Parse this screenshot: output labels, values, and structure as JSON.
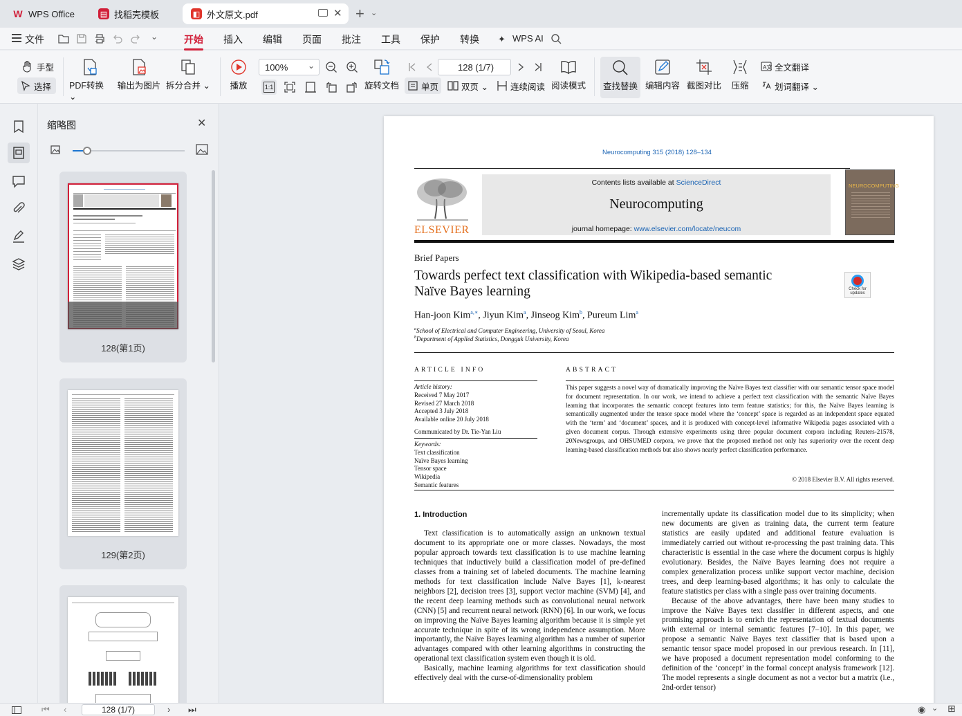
{
  "tabs": [
    {
      "label": "WPS Office"
    },
    {
      "label": "找稻壳模板"
    },
    {
      "label": "外文原文.pdf"
    }
  ],
  "menu": {
    "file": "文件",
    "items": [
      "开始",
      "插入",
      "编辑",
      "页面",
      "批注",
      "工具",
      "保护",
      "转换"
    ],
    "ai": "WPS AI"
  },
  "ribbon": {
    "hand": "手型",
    "select": "选择",
    "pdf_convert": "PDF转换",
    "export_image": "输出为图片",
    "split_merge": "拆分合并",
    "play": "播放",
    "zoom": "100%",
    "rotate": "旋转文档",
    "page_input": "128 (1/7)",
    "single": "单页",
    "double": "双页",
    "continuous": "连续阅读",
    "reading": "阅读模式",
    "find_replace": "查找替换",
    "edit_content": "编辑内容",
    "screenshot_compare": "截图对比",
    "compress": "压缩",
    "full_translate": "全文翻译",
    "word_translate": "划词翻译"
  },
  "thumbs": {
    "title": "缩略图",
    "pages": [
      {
        "label": "128(第1页)"
      },
      {
        "label": "129(第2页)"
      }
    ]
  },
  "status": {
    "page": "128 (1/7)"
  },
  "paper": {
    "journal_ref": "Neurocomputing 315 (2018) 128–134",
    "contents_prefix": "Contents lists available at ",
    "contents_link": "ScienceDirect",
    "journal": "Neurocomputing",
    "homepage_prefix": "journal homepage: ",
    "homepage_link": "www.elsevier.com/locate/neucom",
    "publisher": "ELSEVIER",
    "cover_title": "NEUROCOMPUTING",
    "badge": "Check for updates",
    "section_type": "Brief Papers",
    "title_line1": "Towards perfect text classification with Wikipedia-based semantic",
    "title_line2": "Naïve Bayes learning",
    "authors": [
      {
        "name": "Han-joon Kim",
        "sup": "a,∗"
      },
      {
        "name": "Jiyun Kim",
        "sup": "a"
      },
      {
        "name": "Jinseog Kim",
        "sup": "b"
      },
      {
        "name": "Pureum Lim",
        "sup": "a"
      }
    ],
    "aff_a": "School of Electrical and Computer Engineering, University of Seoul, Korea",
    "aff_b": "Department of Applied Statistics, Dongguk University, Korea",
    "article_info_heading": "ARTICLE INFO",
    "history_label": "Article history:",
    "history": [
      "Received 7 May 2017",
      "Revised 27 March 2018",
      "Accepted 3 July 2018",
      "Available online 20 July 2018"
    ],
    "communicated": "Communicated by Dr. Tie-Yan Liu",
    "keywords_label": "Keywords:",
    "keywords": [
      "Text classification",
      "Naïve Bayes learning",
      "Tensor space",
      "Wikipedia",
      "Semantic features"
    ],
    "abstract_heading": "ABSTRACT",
    "abstract": "This paper suggests a novel way of dramatically improving the Naïve Bayes text classifier with our semantic tensor space model for document representation. In our work, we intend to achieve a perfect text classification with the semantic Naïve Bayes learning that incorporates the semantic concept features into term feature statistics; for this, the Naïve Bayes learning is semantically augmented under the tensor space model where the ‘concept’ space is regarded as an independent space equated with the ‘term’ and ‘document’ spaces, and it is produced with concept-level informative Wikipedia pages associated with a given document corpus. Through extensive experiments using three popular document corpora including Reuters-21578, 20Newsgroups, and OHSUMED corpora, we prove that the proposed method not only has superiority over the recent deep learning-based classification methods but also shows nearly perfect classification performance.",
    "copyright": "© 2018 Elsevier B.V. All rights reserved.",
    "intro_heading": "1. Introduction",
    "intro_p1": "Text classification is to automatically assign an unknown textual document to its appropriate one or more classes. Nowadays, the most popular approach towards text classification is to use machine learning techniques that inductively build a classification model of pre-defined classes from a training set of labeled documents. The machine learning methods for text classification include Naïve Bayes [1], k-nearest neighbors [2], decision trees [3], support vector machine (SVM) [4], and the recent deep learning methods such as convolutional neural network (CNN) [5] and recurrent neural network (RNN) [6]. In our work, we focus on improving the Naïve Bayes learning algorithm because it is simple yet accurate technique in spite of its wrong independence assumption. More importantly, the Naïve Bayes learning algorithm has a number of superior advantages compared with other learning algorithms in constructing the operational text classification system even though it is old.",
    "intro_p2": "Basically, machine learning algorithms for text classification should effectively deal with the curse-of-dimensionality problem",
    "right_p1": "incrementally update its classification model due to its simplicity; when new documents are given as training data, the current term feature statistics are easily updated and additional feature evaluation is immediately carried out without re-processing the past training data. This characteristic is essential in the case where the document corpus is highly evolutionary. Besides, the Naïve Bayes learning does not require a complex generalization process unlike support vector machine, decision trees, and deep learning-based algorithms; it has only to calculate the feature statistics per class with a single pass over training documents.",
    "right_p2": "Because of the above advantages, there have been many studies to improve the Naïve Bayes text classifier in different aspects, and one promising approach is to enrich the representation of textual documents with external or internal semantic features [7–10]. In this paper, we propose a semantic Naïve Bayes text classifier that is based upon a semantic tensor space model proposed in our previous research. In [11], we have proposed a document representation model conforming to the definition of the ‘concept’ in the formal concept analysis framework [12]. The model represents a single document as not a vector but a matrix (i.e., 2nd-order tensor)"
  }
}
